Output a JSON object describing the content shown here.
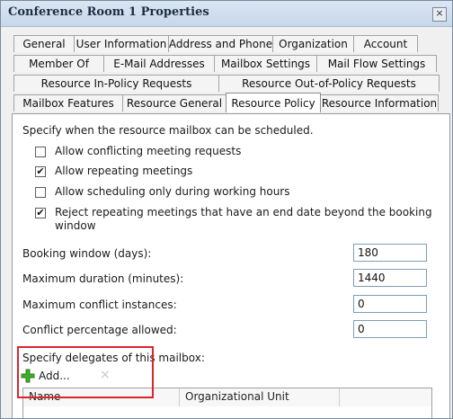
{
  "window": {
    "title": "Conference Room 1 Properties",
    "close": "×"
  },
  "tabs": {
    "row1": [
      "General",
      "User Information",
      "Address and Phone",
      "Organization",
      "Account"
    ],
    "row2": [
      "Member Of",
      "E-Mail Addresses",
      "Mailbox Settings",
      "Mail Flow Settings"
    ],
    "row3": [
      "Resource In-Policy Requests",
      "Resource Out-of-Policy Requests"
    ],
    "row4": [
      "Mailbox Features",
      "Resource General",
      "Resource Policy",
      "Resource Information"
    ],
    "active": "Resource Policy"
  },
  "policy": {
    "schedule_heading": "Specify when the resource mailbox can be scheduled.",
    "checkboxes": [
      {
        "label": "Allow conflicting meeting requests",
        "checked": false
      },
      {
        "label": "Allow repeating meetings",
        "checked": true
      },
      {
        "label": "Allow scheduling only during working hours",
        "checked": false
      },
      {
        "label": "Reject repeating meetings that have an end date beyond the booking",
        "label2": "window",
        "checked": true
      }
    ],
    "fields": [
      {
        "label": "Booking window (days):",
        "value": "180"
      },
      {
        "label": "Maximum duration (minutes):",
        "value": "1440"
      },
      {
        "label": "Maximum conflict instances:",
        "value": "0"
      },
      {
        "label": "Conflict percentage allowed:",
        "value": "0"
      }
    ],
    "delegates_heading": "Specify delegates of this mailbox:",
    "add_label": "Add...",
    "remove_icon": "×",
    "columns": [
      "Name",
      "Organizational Unit"
    ]
  },
  "colors": {
    "highlight_box": "#d9262c",
    "add_icon": "#3fae2a"
  }
}
